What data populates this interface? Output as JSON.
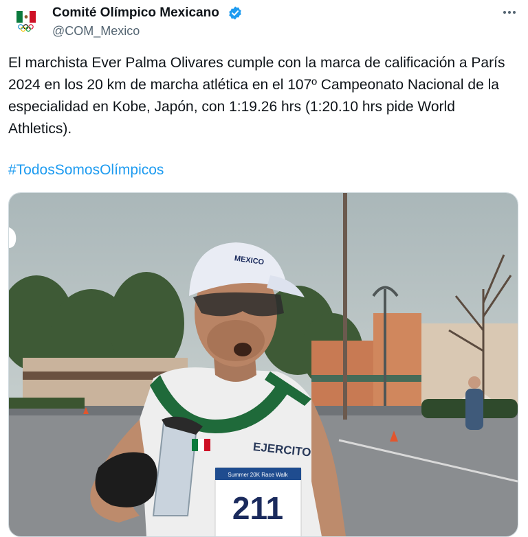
{
  "author": {
    "display_name": "Comité Olímpico Mexicano",
    "handle": "@COM_Mexico",
    "verified": true
  },
  "tweet": {
    "text": "El marchista Ever Palma Olivares cumple con la marca de calificación a París 2024 en los 20 km de marcha atlética en el 107º Campeonato Nacional de la especialidad en Kobe, Japón, con 1:19.26 hrs (1:20.10 hrs pide World Athletics).",
    "hashtag": "#TodosSomosOlímpicos"
  },
  "photo": {
    "cap_text": "MEXICO",
    "shirt_text": "EJERCITO",
    "bib_number": "211",
    "bib_header": "Summer 20K Race Walk"
  },
  "colors": {
    "link": "#1d9bf0",
    "verified": "#1d9bf0",
    "secondary_text": "#536471"
  },
  "icons": {
    "verified": "verified-badge-icon",
    "more": "more-options-icon"
  }
}
